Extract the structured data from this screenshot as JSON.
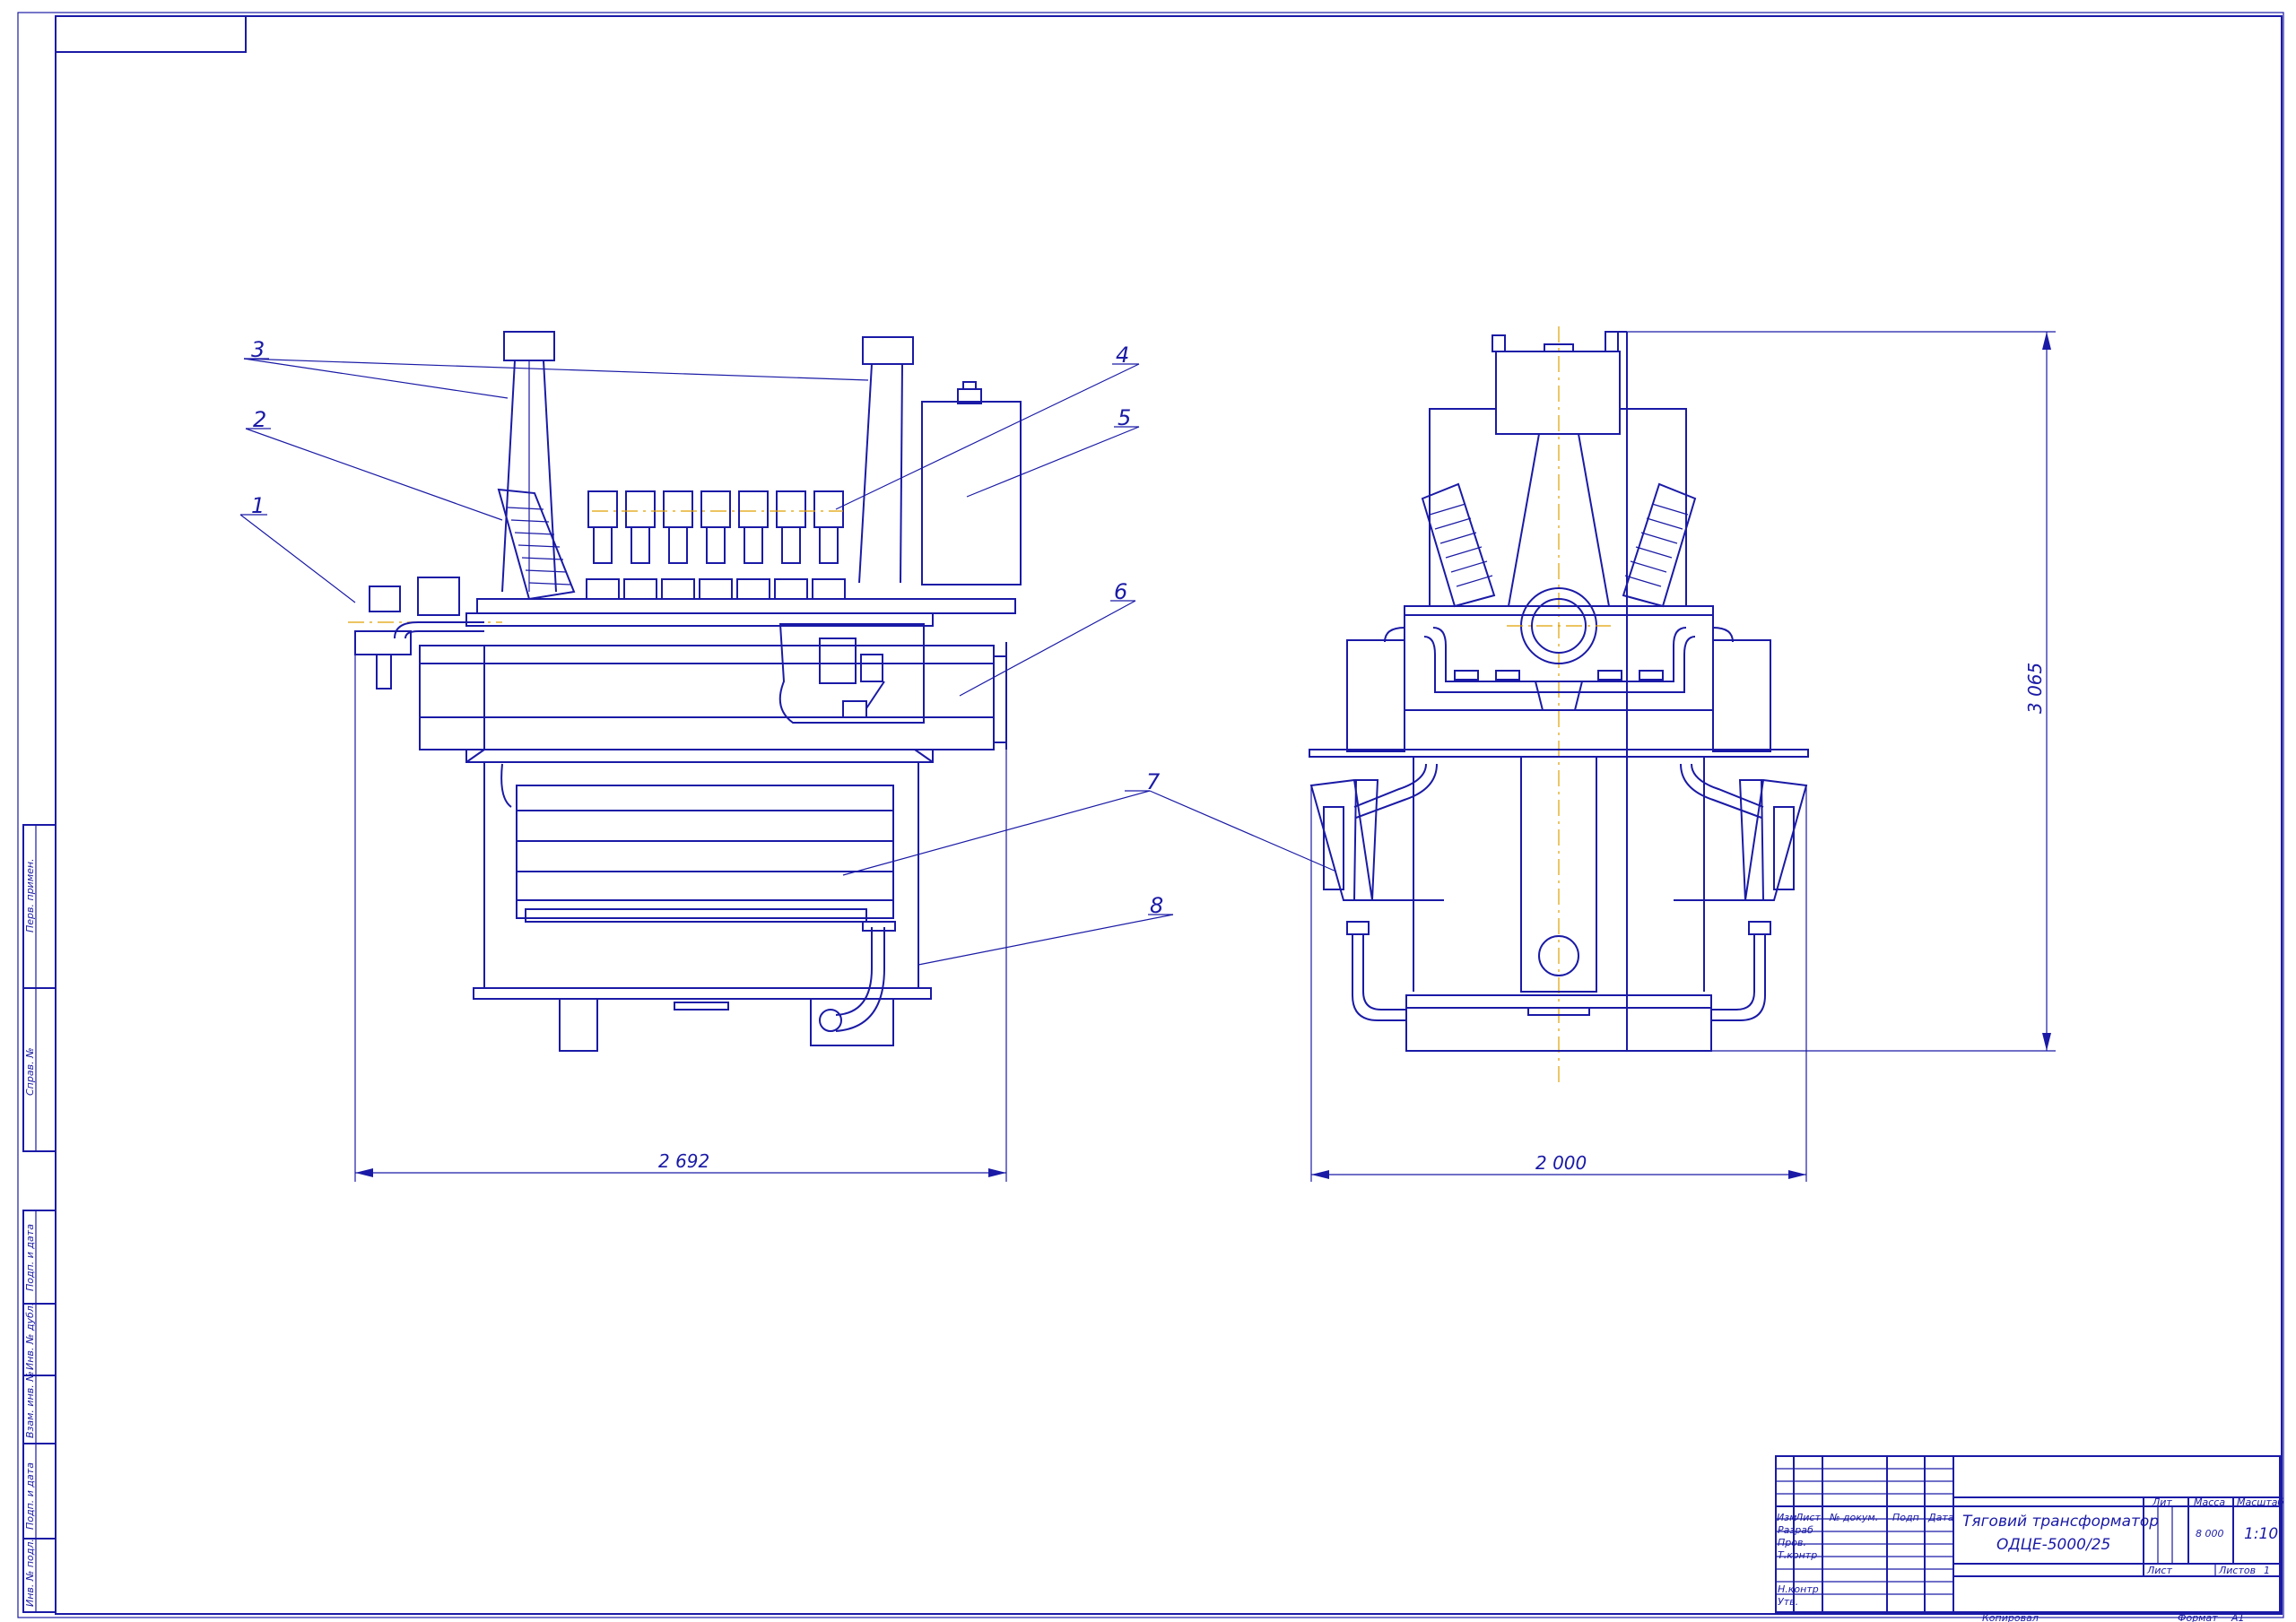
{
  "callouts": [
    "1",
    "2",
    "3",
    "4",
    "5",
    "6",
    "7",
    "8"
  ],
  "dimensions": {
    "side_width": "2 692",
    "front_width": "2 000",
    "height": "3 065"
  },
  "title_block": {
    "title_line1": "Тяговий трансформатор",
    "title_line2": "ОДЦЕ-5000/25",
    "col_izm": "Изм",
    "col_list": "Лист",
    "col_doc": "№ докум.",
    "col_sign": "Подп",
    "col_date": "Дата",
    "row_razrab": "Разраб",
    "row_prov": "Пров.",
    "row_tkontr": "Т.контр",
    "row_nkontr": "Н.контр",
    "row_utv": "Утв.",
    "lit": "Лит",
    "massa": "Масса",
    "masshtab": "Масштаб",
    "mass_value": "8 000",
    "scale_value": "1:10",
    "sheet": "Лист",
    "sheets": "Листов",
    "sheets_value": "1",
    "copied": "Копировал",
    "format": "Формат",
    "format_value": "А1"
  },
  "side_stamp": [
    "Перв. примен.",
    "Справ. №",
    "Подп. и дата",
    "Инв. № дубл.",
    "Взам. инв. №",
    "Подп. и дата",
    "Инв. № подл."
  ],
  "colors": {
    "line": "#1a1aa6",
    "axis": "#e0a000",
    "paper": "#ffffff"
  }
}
